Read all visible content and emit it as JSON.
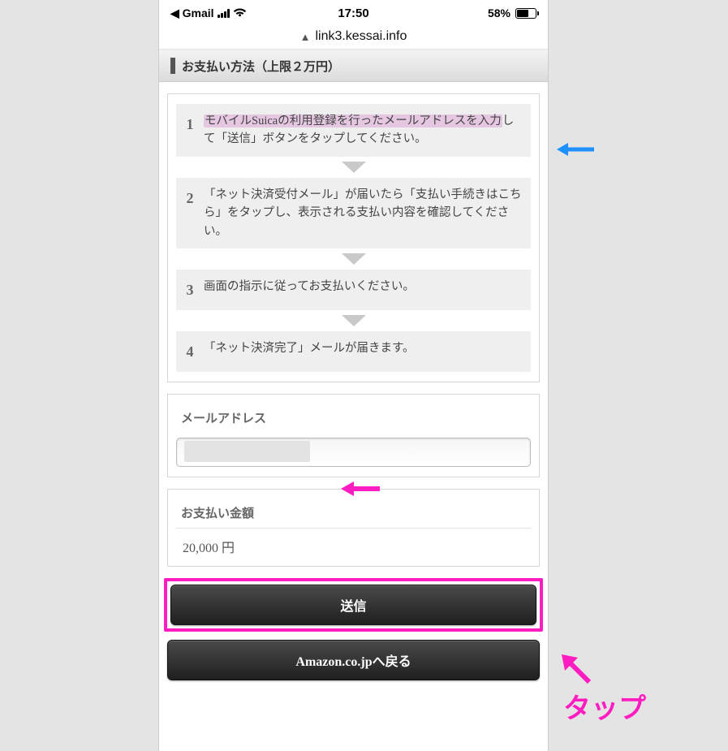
{
  "statusbar": {
    "back_app": "Gmail",
    "time": "17:50",
    "battery_text": "58%",
    "battery_fill_pct": 58
  },
  "urlbar": {
    "domain": "link3.kessai.info"
  },
  "header": {
    "title": "お支払い方法（上限２万円）"
  },
  "steps": {
    "1_hl": "モバイルSuicaの利用登録を行ったメールアドレスを入力",
    "1_tail": "して「送信」ボタンをタップしてください。",
    "2": "「ネット決済受付メール」が届いたら「支払い手続きはこちら」をタップし、表示される支払い内容を確認してください。",
    "3": "画面の指示に従ってお支払いください。",
    "4": "「ネット決済完了」メールが届きます。"
  },
  "email": {
    "label": "メールアドレス",
    "value": ""
  },
  "amount": {
    "label": "お支払い金額",
    "value": "20,000 円"
  },
  "buttons": {
    "submit": "送信",
    "back": "Amazon.co.jpへ戻る"
  },
  "annot": {
    "tap": "タップ"
  }
}
